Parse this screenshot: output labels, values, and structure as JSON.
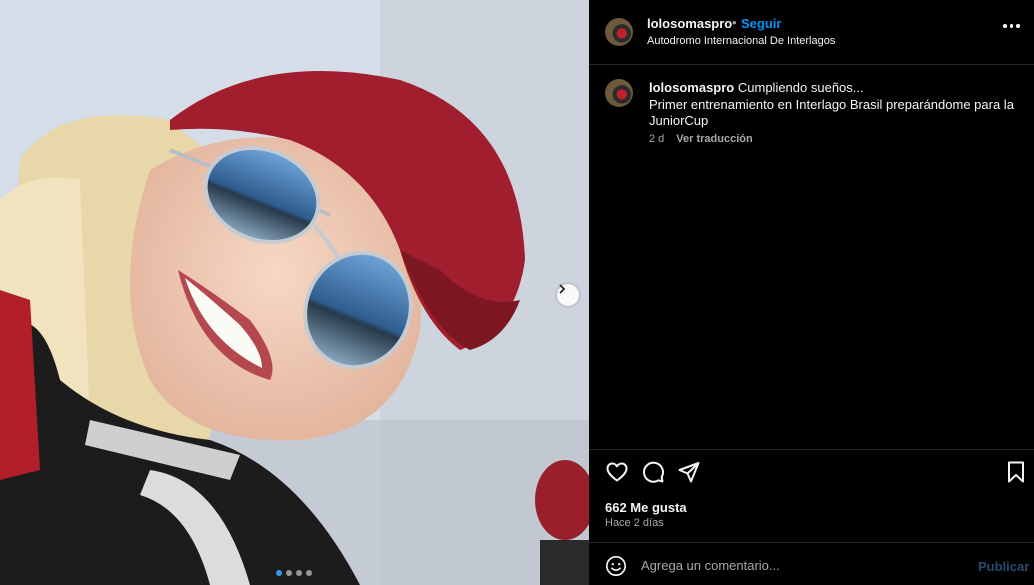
{
  "post": {
    "username": "lolosomaspro",
    "follow_label": "Seguir",
    "separator": "•",
    "location": "Autodromo Internacional De Interlagos",
    "more_icon": "more-horizontal-icon"
  },
  "caption": {
    "username": "lolosomaspro",
    "line1": "Cumpliendo sueños...",
    "line2": "Primer entrenamiento en Interlago Brasil preparándome para la JuniorCup",
    "age": "2 d",
    "translate_label": "Ver traducción"
  },
  "media": {
    "description_icon": "photo",
    "next_icon": "chevron-right-icon",
    "carousel_total": 4,
    "carousel_active": 1
  },
  "actions": {
    "icons": [
      "heart-icon",
      "comment-icon",
      "share-icon",
      "bookmark-icon"
    ]
  },
  "stats": {
    "likes": "662 Me gusta",
    "posted_ago": "Hace 2 días"
  },
  "comment": {
    "placeholder": "Agrega un comentario...",
    "publish_label": "Publicar",
    "emoji_icon": "emoji-icon"
  },
  "colors": {
    "background": "#000000",
    "link_blue": "#0095f6",
    "muted": "#a8a8a8",
    "publish_disabled": "#2b4a6b"
  }
}
